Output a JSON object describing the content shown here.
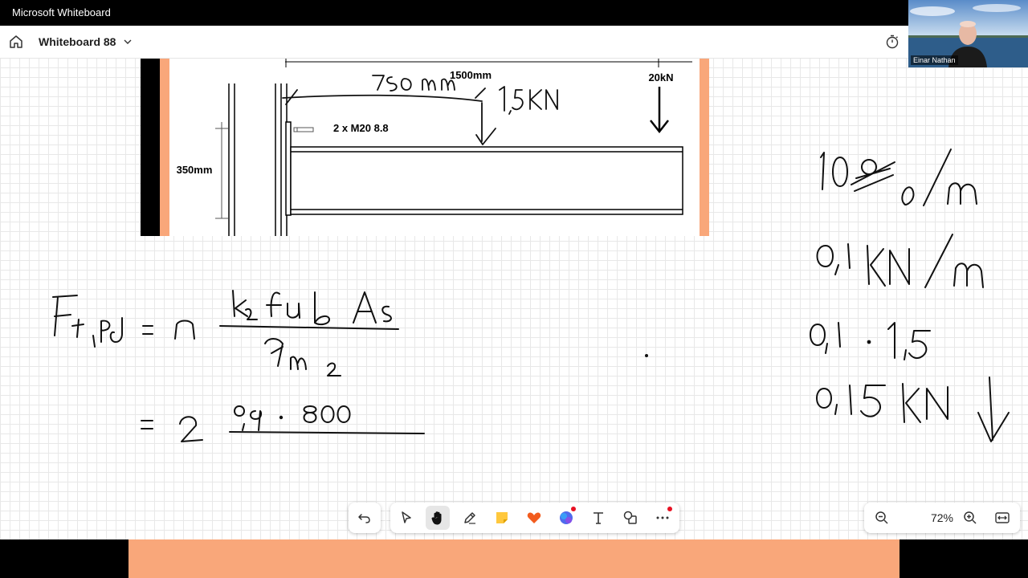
{
  "window": {
    "app_title": "Microsoft Whiteboard"
  },
  "header": {
    "board_name": "Whiteboard 88"
  },
  "video": {
    "participant_name": "Einar Nathan"
  },
  "diagram": {
    "span_label": "1500mm",
    "load_label": "20kN",
    "bolt_label": "2 x M20 8.8",
    "height_label": "350mm"
  },
  "toolbar": {
    "tools": [
      "undo",
      "select",
      "pan",
      "pen",
      "sticky-note",
      "reactions",
      "copilot",
      "text",
      "shapes",
      "more"
    ],
    "active_tool": "pan"
  },
  "zoom": {
    "level": "72%"
  },
  "colors": {
    "accent_orange": "#f9a77a",
    "titlebar": "#000000",
    "notification": "#e81123"
  }
}
